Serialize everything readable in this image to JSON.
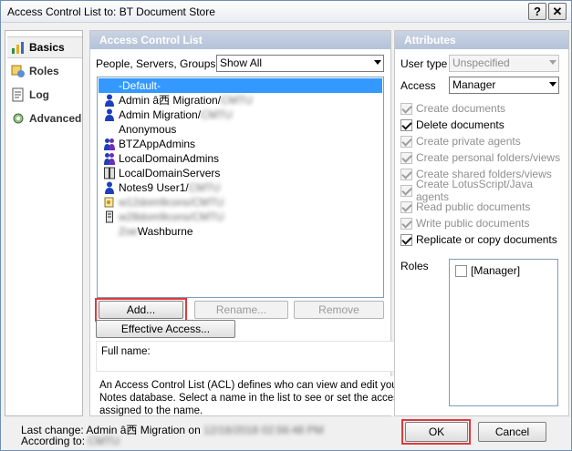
{
  "window": {
    "title": "Access Control List to: BT Document Store",
    "help_glyph": "?",
    "close_glyph": "✕"
  },
  "sidebar": {
    "items": [
      {
        "label": "Basics",
        "icon": "basics-icon",
        "active": true
      },
      {
        "label": "Roles",
        "icon": "roles-icon"
      },
      {
        "label": "Log",
        "icon": "log-icon"
      },
      {
        "label": "Advanced",
        "icon": "advanced-icon"
      }
    ]
  },
  "acl": {
    "header": "Access Control List",
    "filter_label": "People, Servers, Groups",
    "filter_value": "Show All",
    "entries": [
      {
        "pre": "-Default-",
        "blur": "",
        "post": "",
        "icon": "none",
        "selected": true
      },
      {
        "pre": "Admin â西 Migration/",
        "blur": "CMTU",
        "post": "",
        "icon": "person"
      },
      {
        "pre": "Admin Migration/",
        "blur": "CMTU",
        "post": "",
        "icon": "person"
      },
      {
        "pre": "Anonymous",
        "blur": "",
        "post": "",
        "icon": "none"
      },
      {
        "pre": "BTZAppAdmins",
        "blur": "",
        "post": "",
        "icon": "group"
      },
      {
        "pre": "LocalDomainAdmins",
        "blur": "",
        "post": "",
        "icon": "group"
      },
      {
        "pre": "LocalDomainServers",
        "blur": "",
        "post": "",
        "icon": "server-group"
      },
      {
        "pre": "Notes9 User1/",
        "blur": "CMTU",
        "post": "",
        "icon": "person"
      },
      {
        "pre": "",
        "blur": "w12dom9cons/CMTU",
        "post": "",
        "icon": "key"
      },
      {
        "pre": "",
        "blur": "w28dom9cons/CMTU",
        "post": "",
        "icon": "server"
      },
      {
        "pre": "",
        "blur": "Zoe",
        "post": " Washburne",
        "icon": "none"
      }
    ],
    "add_label": "Add...",
    "rename_label": "Rename...",
    "remove_label": "Remove",
    "effective_access_label": "Effective Access...",
    "full_name_label": "Full name:",
    "description": "An Access Control List (ACL) defines who can view and edit your Notes database.  Select a name in the list to see or set the access assigned to the name."
  },
  "attributes": {
    "header": "Attributes",
    "user_type_label": "User type",
    "user_type_value": "Unspecified",
    "access_label": "Access",
    "access_value": "Manager",
    "permissions": [
      {
        "label": "Create documents",
        "checked": true,
        "enabled": false
      },
      {
        "label": "Delete documents",
        "checked": true,
        "enabled": true
      },
      {
        "label": "Create private agents",
        "checked": true,
        "enabled": false
      },
      {
        "label": "Create personal folders/views",
        "checked": true,
        "enabled": false
      },
      {
        "label": "Create shared folders/views",
        "checked": true,
        "enabled": false
      },
      {
        "label": "Create LotusScript/Java agents",
        "checked": true,
        "enabled": false
      },
      {
        "label": "Read public documents",
        "checked": true,
        "enabled": false
      },
      {
        "label": "Write public documents",
        "checked": true,
        "enabled": false
      },
      {
        "label": "Replicate or copy documents",
        "checked": true,
        "enabled": true
      }
    ],
    "roles_label": "Roles",
    "roles": [
      {
        "label": "[Manager]",
        "checked": false
      }
    ]
  },
  "status": {
    "last_change_prefix": "Last change: Admin â西 Migration on ",
    "last_change_blur": "12/16/2018 02:56:48 PM",
    "according_prefix": "According to: ",
    "according_blur": "CMTU"
  },
  "footer": {
    "ok_label": "OK",
    "cancel_label": "Cancel"
  },
  "colors": {
    "highlight": "#e0393e",
    "selection": "#3399ff",
    "panel_header": "#b4c2d8"
  }
}
